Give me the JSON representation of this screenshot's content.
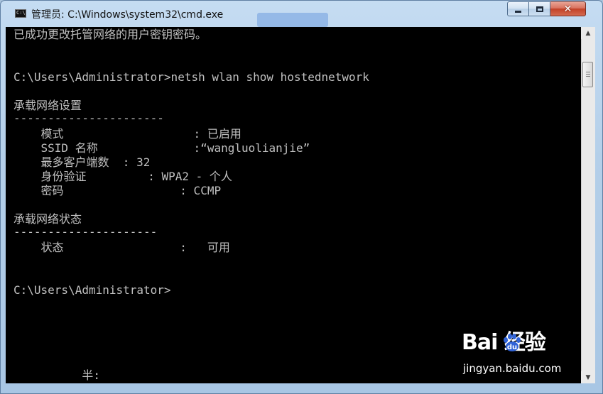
{
  "window": {
    "title": "管理员: C:\\Windows\\system32\\cmd.exe",
    "icon_text": "C:\\"
  },
  "console": {
    "lines": [
      "已成功更改托管网络的用户密钥密码。",
      "C:\\Users\\Administrator>netsh wlan show hostednetwork",
      "承载网络设置",
      "----------------------",
      "    模式                   : 已启用",
      "    SSID 名称              :“wangluolianjie”",
      "    最多客户端数  : 32",
      "    身份验证         : WPA2 - 个人",
      "    密码                 : CCMP",
      "承载网络状态",
      "---------------------",
      "    状态                 :   可用",
      "C:\\Users\\Administrator>",
      "          半:"
    ]
  },
  "watermark": {
    "brand": "Bai  经验",
    "url": "jingyan.baidu.com"
  },
  "colors": {
    "console_bg": "#000000",
    "console_text": "#c0c0c0",
    "close_button": "#c24127"
  },
  "icons": {
    "window_icon": "cmd-icon",
    "minimize": "minimize-icon",
    "maximize": "maximize-icon",
    "close": "close-icon",
    "scroll_up": "chevron-up-icon",
    "scroll_down": "chevron-down-icon",
    "watermark_logo": "baidu-paw-icon"
  }
}
